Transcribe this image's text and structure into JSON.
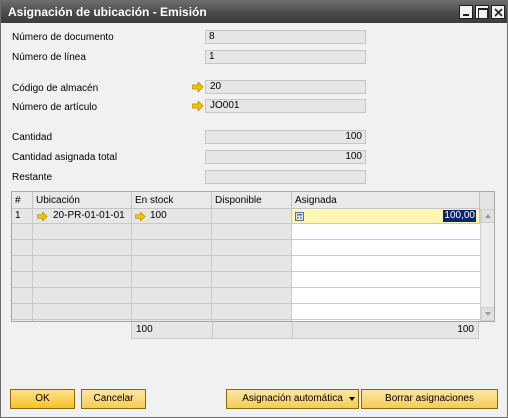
{
  "window": {
    "title": "Asignación de ubicación - Emisión"
  },
  "form": {
    "doc_number_label": "Número de documento",
    "doc_number_value": "8",
    "line_number_label": "Número de línea",
    "line_number_value": "1",
    "warehouse_label": "Código de almacén",
    "warehouse_value": "20",
    "item_label": "Número de artículo",
    "item_value": "JO001",
    "quantity_label": "Cantidad",
    "quantity_value": "100",
    "total_assigned_label": "Cantidad asignada total",
    "total_assigned_value": "100",
    "remaining_label": "Restante",
    "remaining_value": ""
  },
  "grid": {
    "headers": [
      "#",
      "Ubicación",
      "En stock",
      "Disponible",
      "Asignada"
    ],
    "row1": {
      "index": "1",
      "location": "20-PR-01-01-01",
      "in_stock": "100",
      "available": "",
      "assigned": "100,00"
    },
    "totals": {
      "in_stock": "100",
      "assigned": "100"
    }
  },
  "buttons": {
    "ok": "OK",
    "cancel": "Cancelar",
    "auto_assign": "Asignación automática",
    "clear": "Borrar asignaciones"
  },
  "colors": {
    "titlebar": "#4a4a4a",
    "button": "#f7c02a",
    "link_arrow": "#f3c300",
    "selected_row": "#fff6b3"
  }
}
